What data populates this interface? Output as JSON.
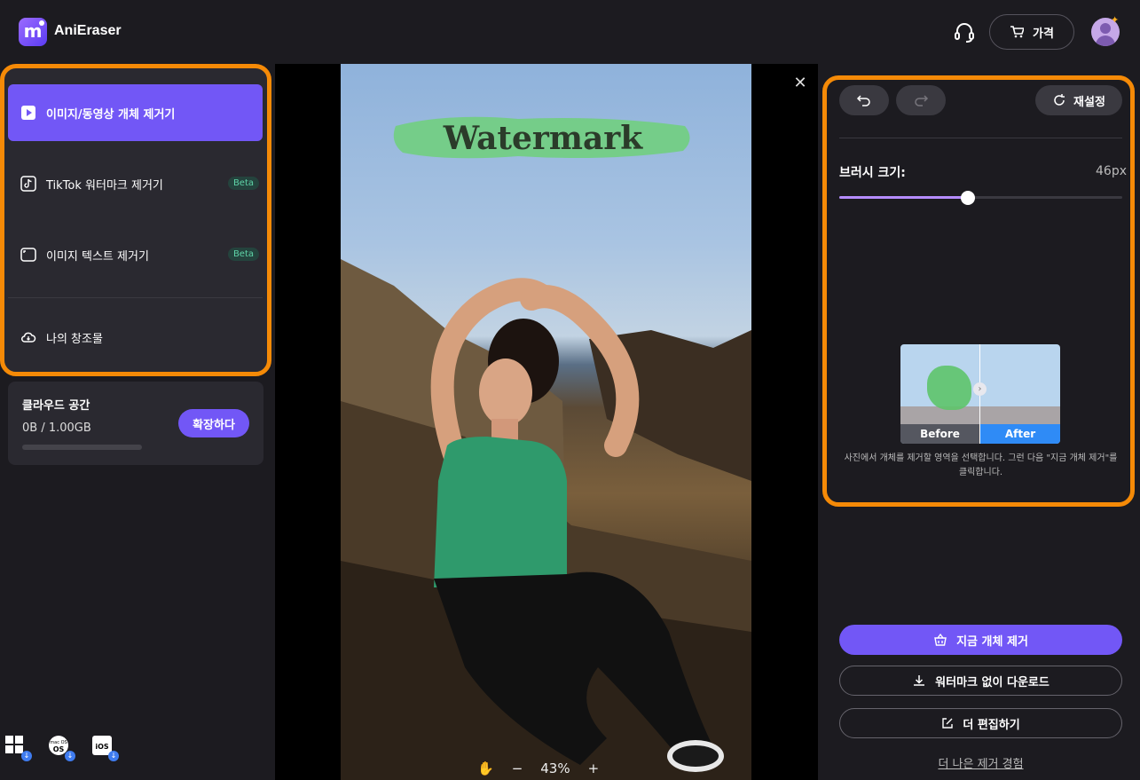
{
  "header": {
    "app_title": "AniEraser",
    "logo_letter": "m",
    "price_label": "가격"
  },
  "sidebar": {
    "items": [
      {
        "label": "이미지/동영상 개체 제거기",
        "icon": "play-icon",
        "active": true
      },
      {
        "label": "TikTok 워터마크 제거기",
        "icon": "tiktok-icon",
        "badge": "Beta"
      },
      {
        "label": "이미지 텍스트 제거기",
        "icon": "image-text-icon",
        "badge": "Beta"
      },
      {
        "label": "나의 창조물",
        "icon": "cloud-icon"
      }
    ],
    "cloud": {
      "title": "클라우드 공간",
      "usage": "0B / 1.00GB",
      "usage_fraction": 0,
      "expand_label": "확장하다"
    },
    "platforms": [
      "windows-icon",
      "macos-icon",
      "ios-icon"
    ],
    "platform_labels": {
      "macos": "mac OS",
      "ios": "iOS"
    }
  },
  "canvas": {
    "watermark_text": "Watermark",
    "zoom": "43%",
    "zoom_out": "−",
    "zoom_in": "+"
  },
  "tools": {
    "reset_label": "재설정",
    "brush_label": "브러시 크기:",
    "brush_value": "46px",
    "brush_fraction": 0.455,
    "preview_before": "Before",
    "preview_after": "After",
    "hint": "사진에서 개체를 제거할 영역을 선택합니다. 그런 다음 \"지금 개체 제거\"를 클릭합니다."
  },
  "actions": {
    "remove_label": "지금 개체 제거",
    "download_label": "워터마크 없이 다운로드",
    "edit_label": "더 편집하기",
    "better_label": "더 나은 제거 경험"
  },
  "colors": {
    "accent": "#7257f6",
    "highlight": "#f58a07",
    "background": "#1c1b20",
    "panel": "#2a2930"
  }
}
